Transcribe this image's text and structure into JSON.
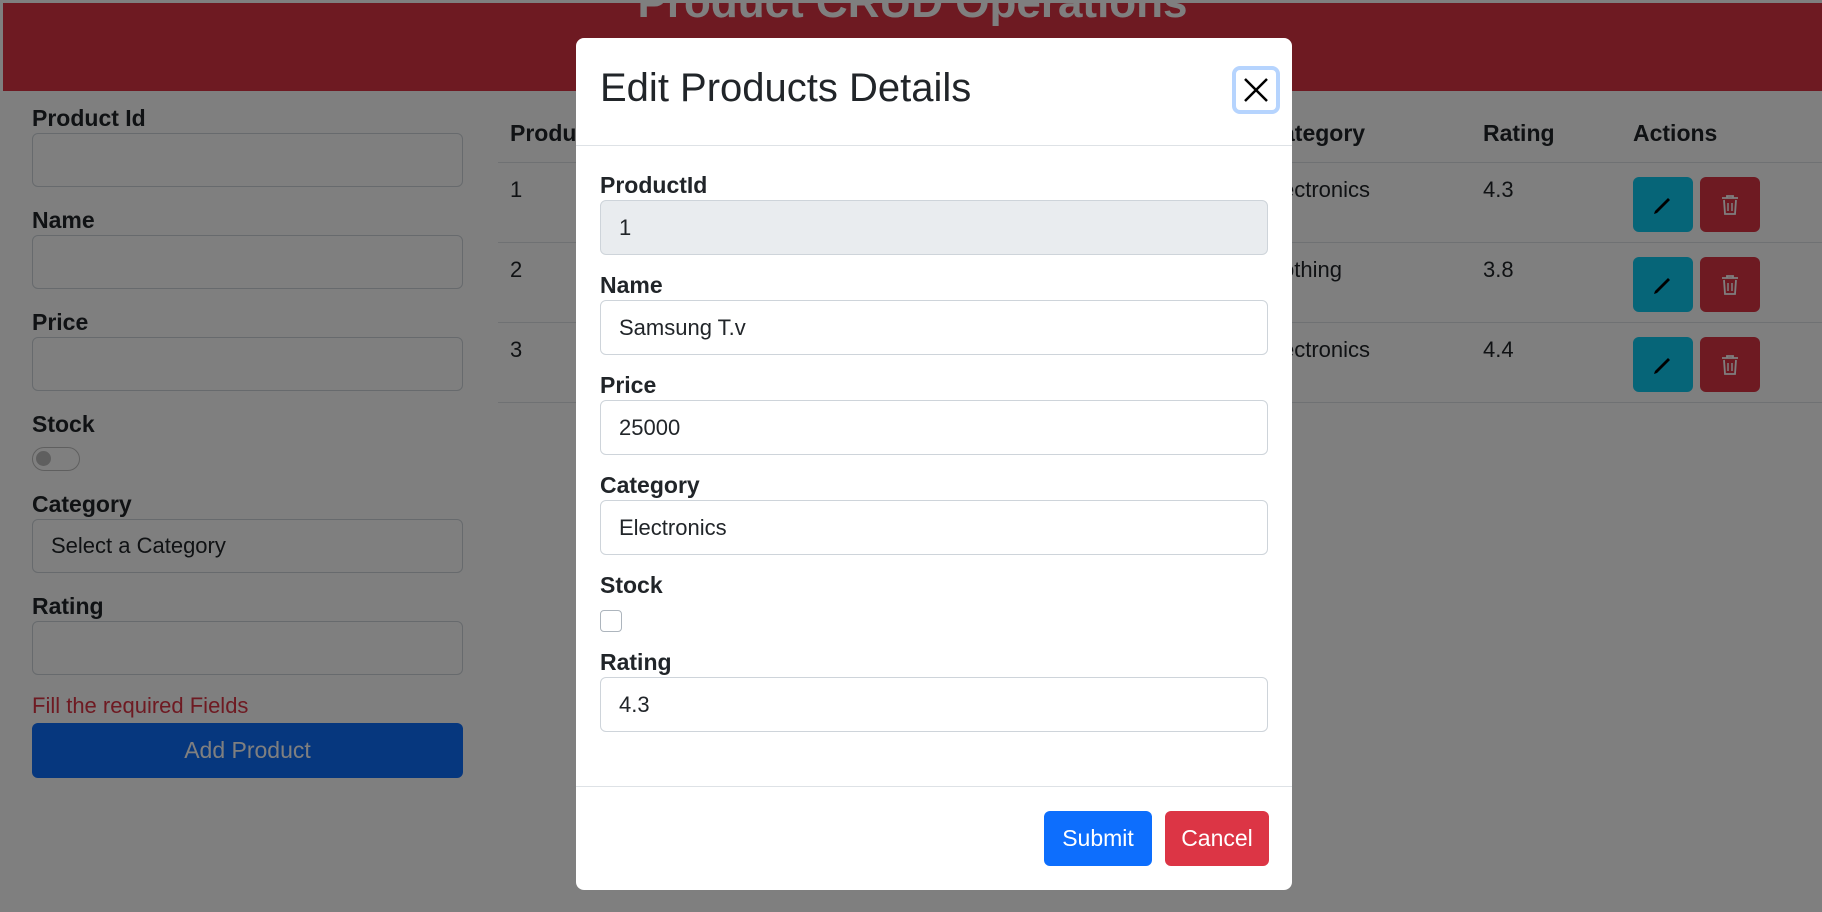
{
  "header": {
    "title": "Product CRUD Operations"
  },
  "form": {
    "product_id_label": "Product Id",
    "name_label": "Name",
    "price_label": "Price",
    "stock_label": "Stock",
    "category_label": "Category",
    "category_placeholder": "Select a Category",
    "rating_label": "Rating",
    "error_text": "Fill the required Fields",
    "add_button": "Add Product"
  },
  "table": {
    "headers": {
      "id": "Produ",
      "category": "ategory",
      "rating": "Rating",
      "actions": "Actions"
    },
    "rows": [
      {
        "id": "1",
        "category": "ectronics",
        "rating": "4.3"
      },
      {
        "id": "2",
        "category": "othing",
        "rating": "3.8"
      },
      {
        "id": "3",
        "category": "ectronics",
        "rating": "4.4"
      }
    ]
  },
  "modal": {
    "title": "Edit Products Details",
    "fields": {
      "product_id_label": "ProductId",
      "product_id_value": "1",
      "name_label": "Name",
      "name_value": "Samsung T.v",
      "price_label": "Price",
      "price_value": "25000",
      "category_label": "Category",
      "category_value": "Electronics",
      "stock_label": "Stock",
      "stock_checked": false,
      "rating_label": "Rating",
      "rating_value": "4.3"
    },
    "submit_label": "Submit",
    "cancel_label": "Cancel"
  },
  "colors": {
    "header_bg": "#dc3545",
    "primary": "#0d6efd",
    "info": "#0dcaf0",
    "danger": "#dc3545"
  },
  "icons": {
    "edit": "pencil-icon",
    "delete": "trash-icon",
    "close": "close-icon"
  }
}
